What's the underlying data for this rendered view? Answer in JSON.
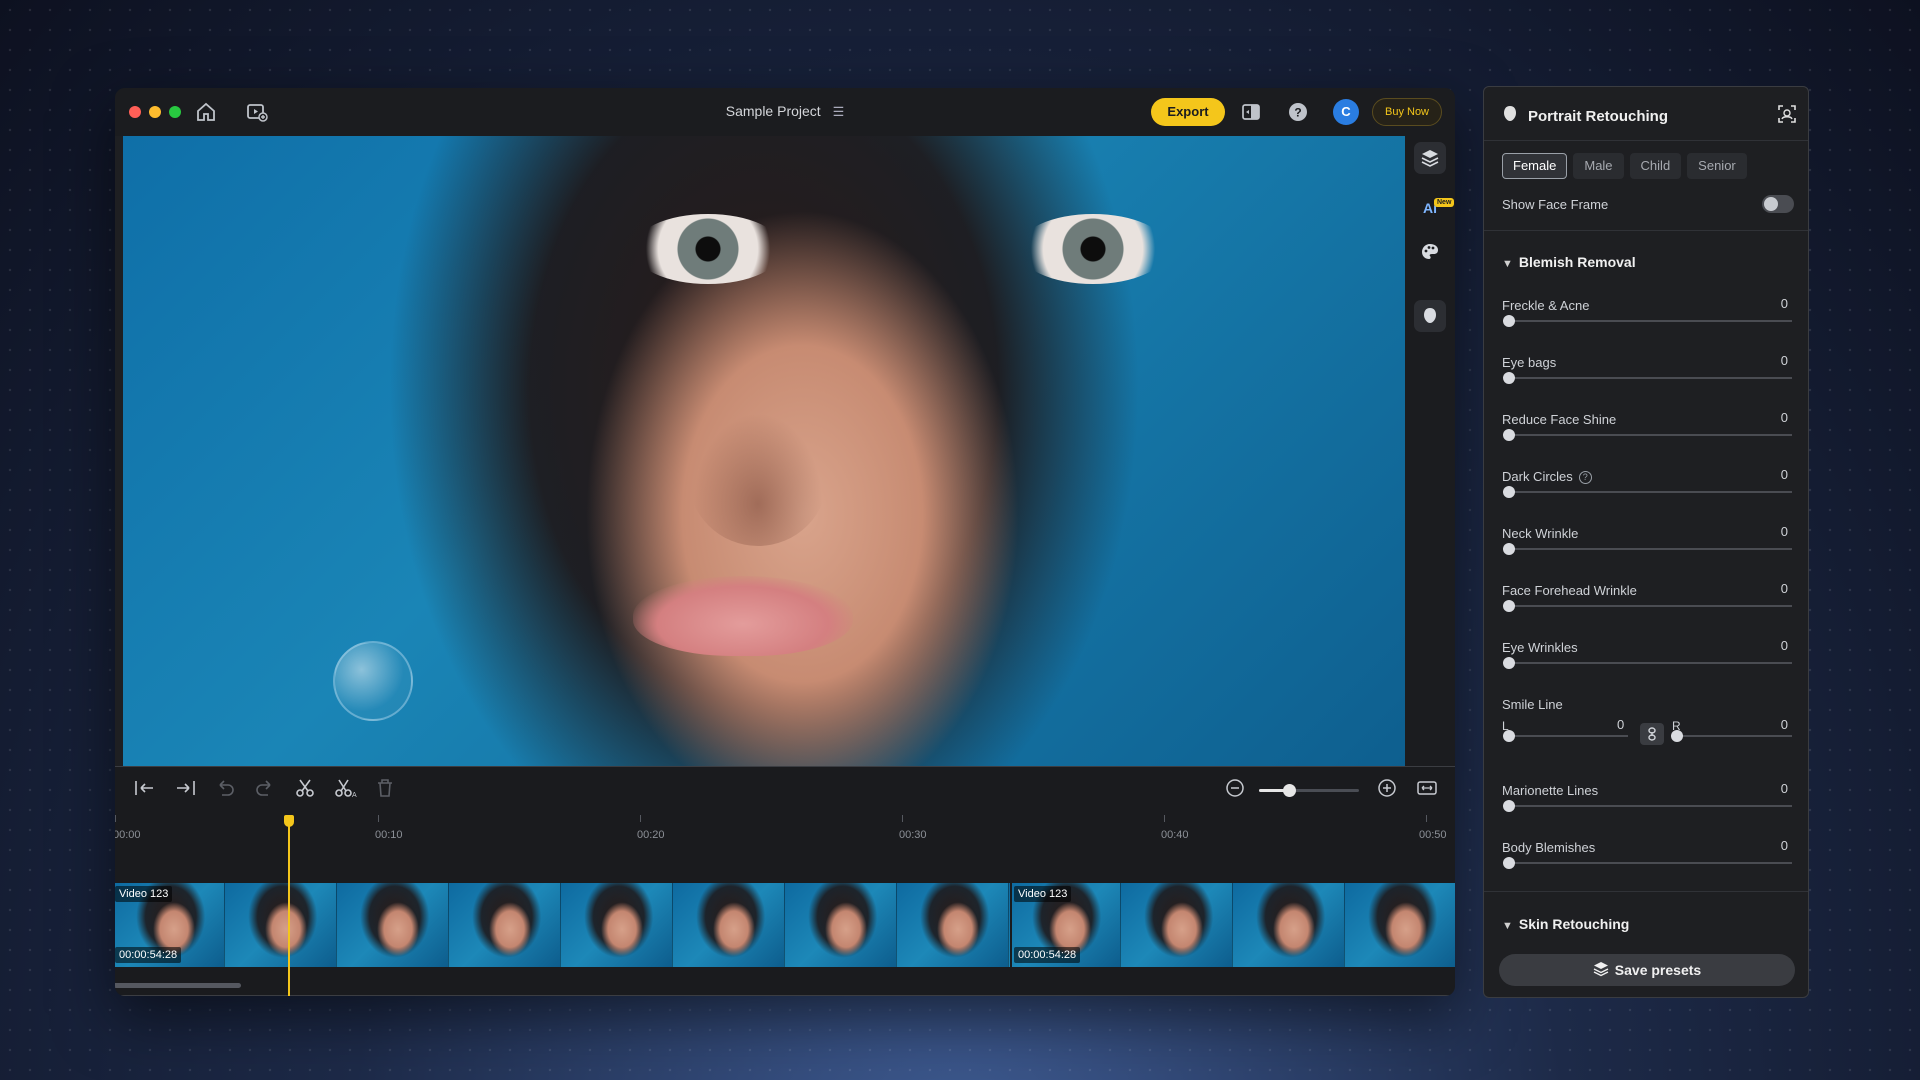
{
  "app": {
    "project_title": "Sample Project",
    "export_label": "Export",
    "avatar_letter": "C",
    "buy_label": "Buy Now",
    "new_badge": "New",
    "colors": {
      "accent": "#f4c61b",
      "avatar": "#2a7de1",
      "close": "#ff5f57",
      "min": "#febc2e",
      "max": "#28c840"
    }
  },
  "timeline": {
    "ruler": [
      "00:00",
      "00:10",
      "00:20",
      "00:30",
      "00:40",
      "00:50"
    ],
    "zoom_level": 0.3,
    "clips": [
      {
        "name": "Video 123",
        "duration": "00:00:54:28"
      },
      {
        "name": "Video 123",
        "duration": "00:00:54:28"
      }
    ]
  },
  "panel": {
    "title": "Portrait Retouching",
    "segments": [
      "Female",
      "Male",
      "Child",
      "Senior"
    ],
    "selected_segment": "Female",
    "show_face_frame": {
      "label": "Show Face Frame",
      "on": false
    },
    "blemish": {
      "title": "Blemish Removal",
      "sliders": [
        {
          "label": "Freckle & Acne",
          "value": "0"
        },
        {
          "label": "Eye bags",
          "value": "0"
        },
        {
          "label": "Reduce Face Shine",
          "value": "0"
        },
        {
          "label": "Dark Circles",
          "value": "0"
        },
        {
          "label": "Neck Wrinkle",
          "value": "0"
        },
        {
          "label": "Face Forehead Wrinkle",
          "value": "0"
        },
        {
          "label": "Eye Wrinkles",
          "value": "0"
        }
      ],
      "smile_line": {
        "label": "Smile Line",
        "left_label": "L",
        "left_value": "0",
        "right_label": "R",
        "right_value": "0"
      },
      "sliders2": [
        {
          "label": "Marionette Lines",
          "value": "0"
        },
        {
          "label": "Body Blemishes",
          "value": "0"
        }
      ]
    },
    "skin": {
      "title": "Skin Retouching"
    },
    "save_label": "Save presets"
  }
}
